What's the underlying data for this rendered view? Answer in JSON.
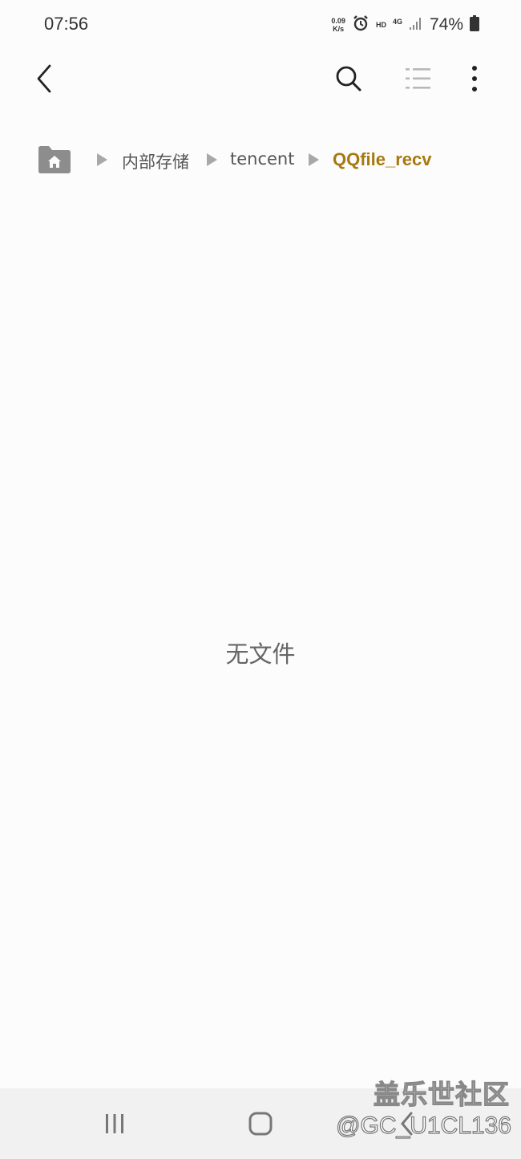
{
  "status_bar": {
    "time": "07:56",
    "net_speed_value": "0.09",
    "net_speed_unit": "K/s",
    "hd_label": "HD",
    "network_label": "4G",
    "battery_percent": "74%",
    "icons": [
      "alarm-icon",
      "signal-icon",
      "battery-icon"
    ]
  },
  "toolbar": {
    "icons": [
      "back-icon",
      "search-icon",
      "list-view-icon",
      "more-icon"
    ]
  },
  "breadcrumb": {
    "home_icon": "home-folder-icon",
    "items": [
      {
        "label": "内部存储"
      },
      {
        "label": "tencent"
      },
      {
        "label": "QQfile_recv",
        "active": true
      }
    ],
    "colors": {
      "active": "#a77a10",
      "inactive": "#555555"
    }
  },
  "main": {
    "empty_text": "无文件"
  },
  "navbar": {
    "icons": [
      "recents-icon",
      "home-icon",
      "back-icon"
    ]
  },
  "watermark": {
    "title": "盖乐世社区",
    "handle": "@GC_U1CL136"
  }
}
